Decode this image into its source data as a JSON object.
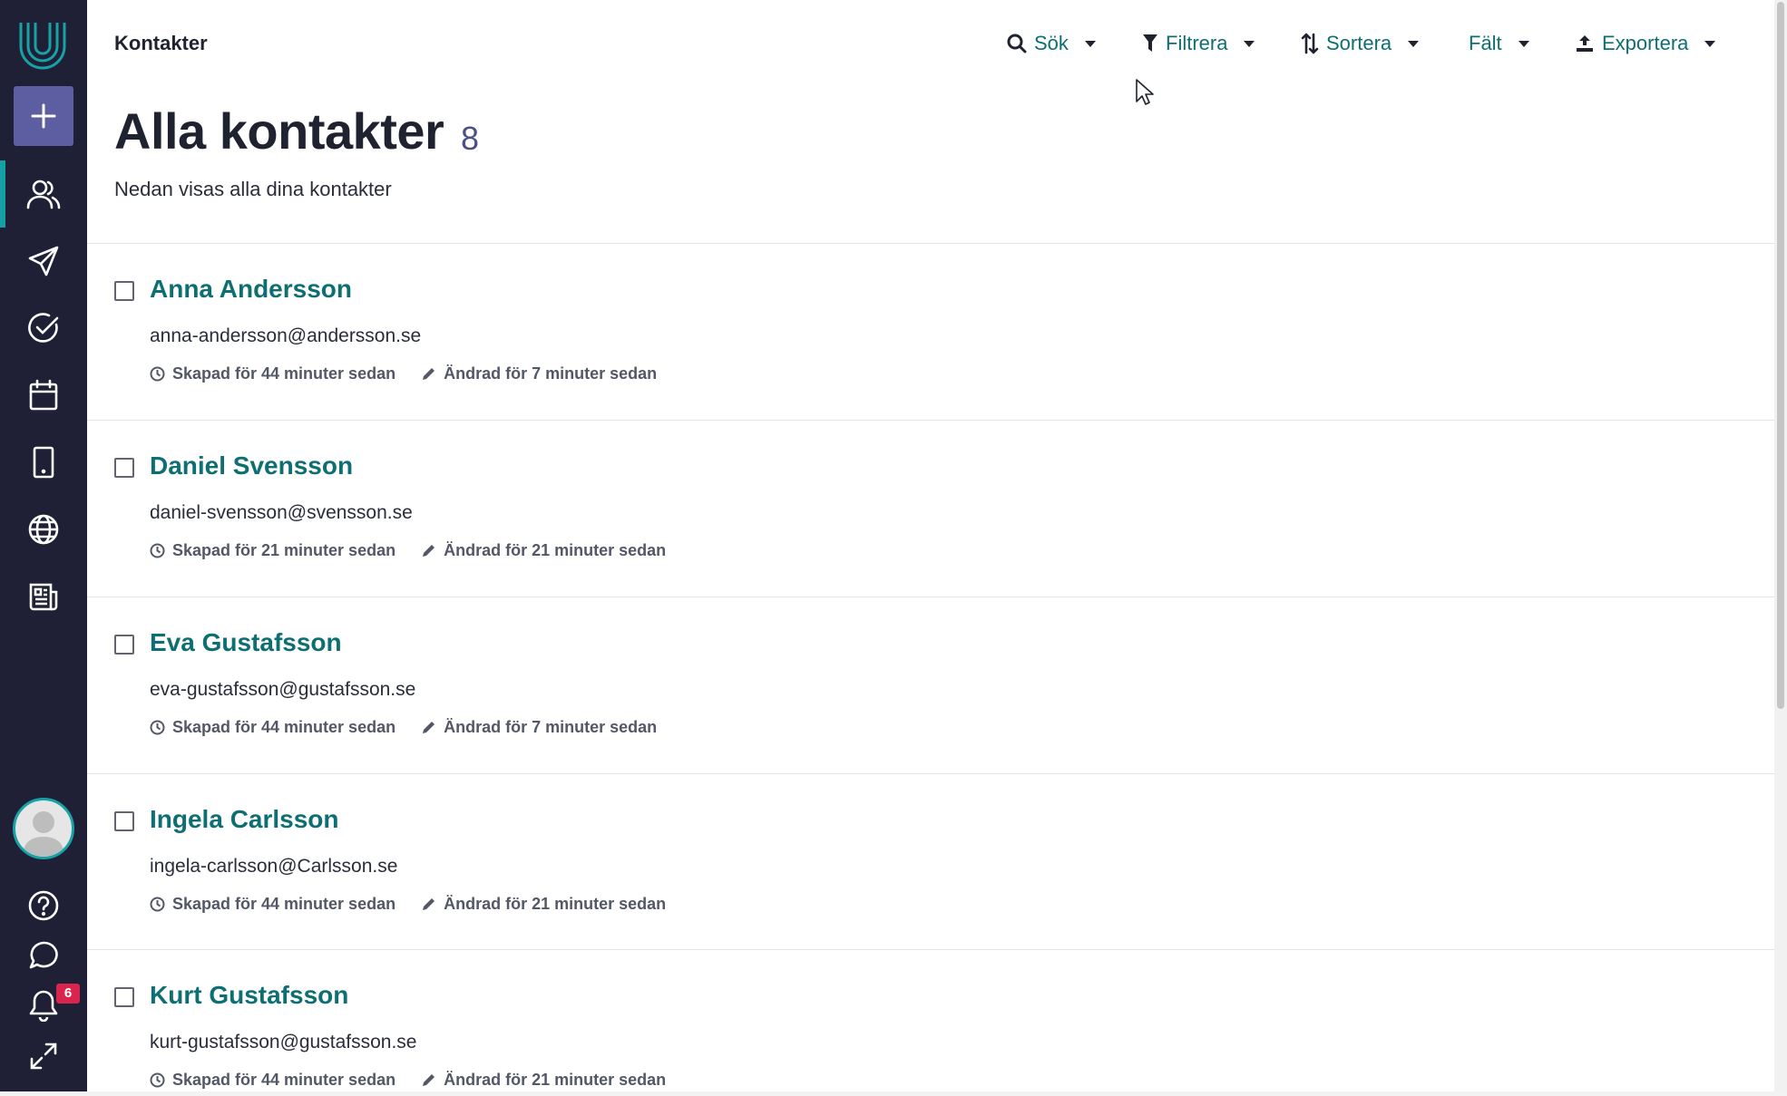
{
  "sidebar": {
    "logo": "logo-icon",
    "add_icon": "plus-icon",
    "nav": [
      "contacts-icon",
      "send-icon",
      "check-circle-icon",
      "calendar-icon",
      "tablet-icon",
      "globe-icon",
      "document-list-icon"
    ],
    "bottom": [
      "help-icon",
      "chat-icon",
      "bell-icon",
      "expand-icon"
    ],
    "notification_count": "6",
    "colors": {
      "bg": "#1f2036",
      "accent": "#14a0a4",
      "add": "#5d5ea2"
    }
  },
  "topbar": {
    "breadcrumb": "Kontakter",
    "tools": [
      {
        "label": "Sök",
        "icon": "search-icon"
      },
      {
        "label": "Filtrera",
        "icon": "filter-icon"
      },
      {
        "label": "Sortera",
        "icon": "sort-icon"
      },
      {
        "label": "Fält",
        "icon": ""
      },
      {
        "label": "Exportera",
        "icon": "export-icon"
      }
    ]
  },
  "header": {
    "title": "Alla kontakter",
    "count": "8",
    "subtitle": "Nedan visas alla dina kontakter"
  },
  "contacts": [
    {
      "name": "Anna Andersson",
      "email": "anna-andersson@andersson.se",
      "created": "Skapad för 44 minuter sedan",
      "modified": "Ändrad för 7 minuter sedan"
    },
    {
      "name": "Daniel Svensson",
      "email": "daniel-svensson@svensson.se",
      "created": "Skapad för 21 minuter sedan",
      "modified": "Ändrad för 21 minuter sedan"
    },
    {
      "name": "Eva Gustafsson",
      "email": "eva-gustafsson@gustafsson.se",
      "created": "Skapad för 44 minuter sedan",
      "modified": "Ändrad för 7 minuter sedan"
    },
    {
      "name": "Ingela Carlsson",
      "email": "ingela-carlsson@Carlsson.se",
      "created": "Skapad för 44 minuter sedan",
      "modified": "Ändrad för 21 minuter sedan"
    },
    {
      "name": "Kurt Gustafsson",
      "email": "kurt-gustafsson@gustafsson.se",
      "created": "Skapad för 44 minuter sedan",
      "modified": "Ändrad för 21 minuter sedan"
    }
  ],
  "colors": {
    "link": "#0e6f73",
    "text": "#1f2330",
    "meta": "#525866"
  }
}
